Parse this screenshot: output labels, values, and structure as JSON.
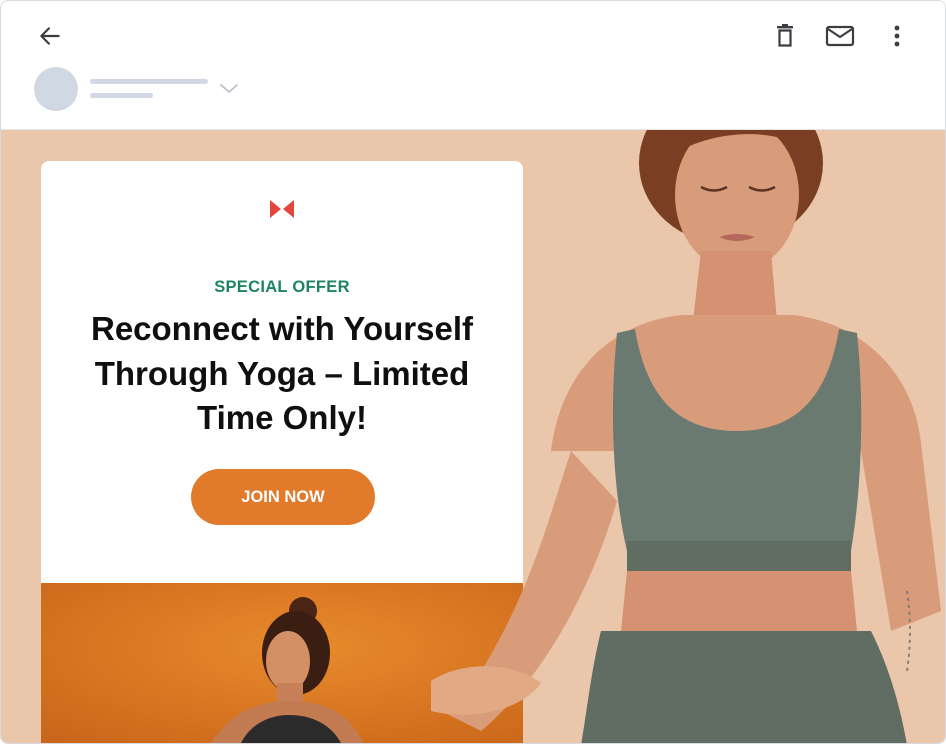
{
  "email": {
    "eyebrow": "SPECIAL OFFER",
    "headline": "Reconnect with Yourself Through Yoga – Limited Time Only!",
    "cta_label": "JOIN NOW"
  },
  "icons": {
    "back": "arrow-left-icon",
    "delete": "trash-icon",
    "mail": "mail-icon",
    "more": "more-vertical-icon",
    "expand": "chevron-down-icon"
  },
  "colors": {
    "canvas": "#eac6ab",
    "eyebrow": "#1e8463",
    "cta": "#e17a2b",
    "placeholder": "#cfd8e3",
    "logo": "#e2463d"
  }
}
